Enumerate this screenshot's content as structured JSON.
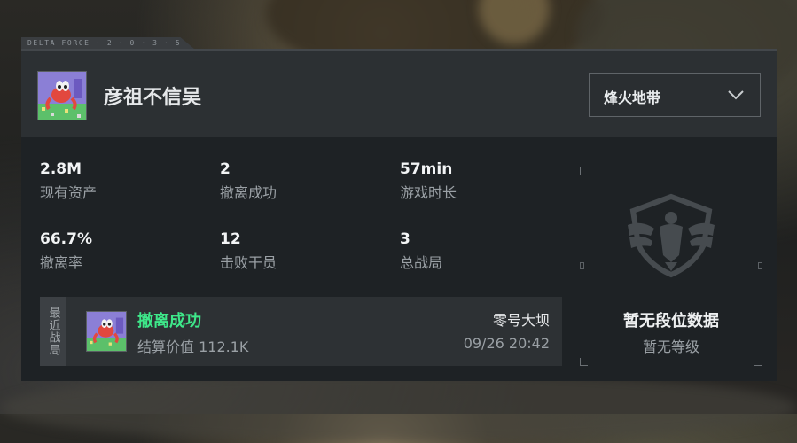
{
  "brand": "DELTA FORCE · 2 · 0 · 3 · 5",
  "player": {
    "name": "彦祖不信吴",
    "avatar_icon": "cartoon-avatar-icon"
  },
  "mode_selector": {
    "selected": "烽火地带",
    "icon": "chevron-down-icon"
  },
  "stats": [
    {
      "value": "2.8M",
      "label": "现有资产"
    },
    {
      "value": "2",
      "label": "撤离成功"
    },
    {
      "value": "57min",
      "label": "游戏时长"
    },
    {
      "value": "66.7%",
      "label": "撤离率"
    },
    {
      "value": "12",
      "label": "击败干员"
    },
    {
      "value": "3",
      "label": "总战局"
    }
  ],
  "recent_match": {
    "side_label": "最近战局",
    "status": "撤离成功",
    "value_text": "结算价值 112.1K",
    "map": "零号大坝",
    "time": "09/26 20:42",
    "status_color": "#3ee88a"
  },
  "rank": {
    "title": "暂无段位数据",
    "subtitle": "暂无等级",
    "emblem_icon": "eagle-emblem-icon"
  }
}
